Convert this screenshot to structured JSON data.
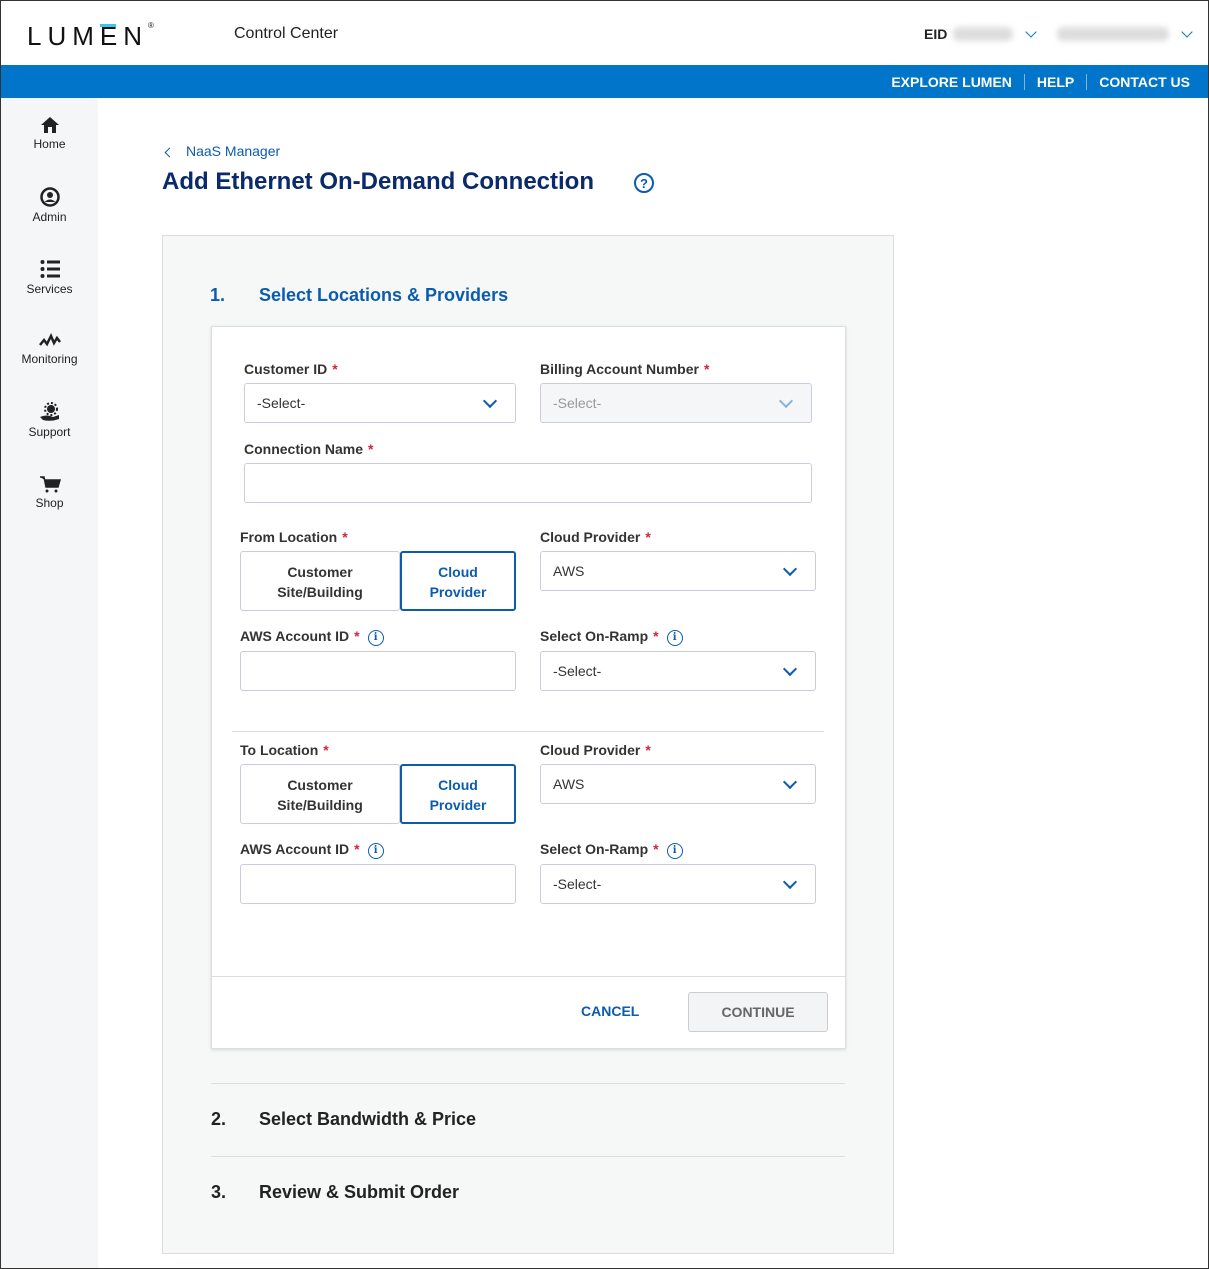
{
  "header": {
    "logo": "LUMEN",
    "app_name": "Control Center",
    "eid_label": "EID",
    "links": [
      "EXPLORE LUMEN",
      "HELP",
      "CONTACT US"
    ]
  },
  "sidebar": {
    "items": [
      {
        "label": "Home",
        "icon": "home-icon"
      },
      {
        "label": "Admin",
        "icon": "user-circle-icon"
      },
      {
        "label": "Services",
        "icon": "list-icon"
      },
      {
        "label": "Monitoring",
        "icon": "pulse-icon"
      },
      {
        "label": "Support",
        "icon": "support-icon"
      },
      {
        "label": "Shop",
        "icon": "cart-icon"
      }
    ]
  },
  "breadcrumb": "NaaS Manager",
  "page_title": "Add Ethernet On-Demand Connection",
  "steps": [
    {
      "num": "1.",
      "label": "Select Locations & Providers"
    },
    {
      "num": "2.",
      "label": "Select Bandwidth & Price"
    },
    {
      "num": "3.",
      "label": "Review & Submit Order"
    }
  ],
  "form": {
    "customer_id": {
      "label": "Customer ID",
      "value": "-Select-"
    },
    "billing_account": {
      "label": "Billing Account Number",
      "value": "-Select-"
    },
    "connection_name": {
      "label": "Connection Name",
      "value": ""
    },
    "from": {
      "label": "From Location",
      "options": [
        "Customer Site/Building",
        "Cloud Provider"
      ],
      "selected": "Cloud Provider",
      "provider_label": "Cloud Provider",
      "provider": "AWS",
      "account_label": "AWS Account ID",
      "account": "",
      "onramp_label": "Select On-Ramp",
      "onramp": "-Select-"
    },
    "to": {
      "label": "To Location",
      "options": [
        "Customer Site/Building",
        "Cloud Provider"
      ],
      "selected": "Cloud Provider",
      "provider_label": "Cloud Provider",
      "provider": "AWS",
      "account_label": "AWS Account ID",
      "account": "",
      "onramp_label": "Select On-Ramp",
      "onramp": "-Select-"
    },
    "cancel": "CANCEL",
    "continue": "CONTINUE"
  }
}
